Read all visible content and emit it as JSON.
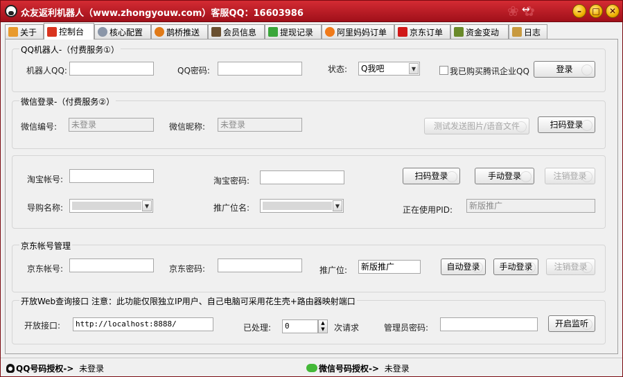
{
  "window": {
    "title": "众友返利机器人（www.zhongyouw.com）客服QQ：16603986",
    "resize_glyph": "↔",
    "min_glyph": "–",
    "max_glyph": "□",
    "close_glyph": "✕"
  },
  "tabs": [
    {
      "label": "关于",
      "icon": "home-icon",
      "color": "#e89a2e"
    },
    {
      "label": "控制台",
      "icon": "shield-icon",
      "color": "#d9341f"
    },
    {
      "label": "核心配置",
      "icon": "gear-icon",
      "color": "#8a96a8"
    },
    {
      "label": "鹊桥推送",
      "icon": "clock-icon",
      "color": "#e07a18"
    },
    {
      "label": "会员信息",
      "icon": "users-icon",
      "color": "#6a5030"
    },
    {
      "label": "提现记录",
      "icon": "check-icon",
      "color": "#3aa63a"
    },
    {
      "label": "阿里妈妈订单",
      "icon": "alimama-icon",
      "color": "#f07a1a"
    },
    {
      "label": "京东订单",
      "icon": "jd-icon",
      "color": "#d01818"
    },
    {
      "label": "资金变动",
      "icon": "money-icon",
      "color": "#6a8a2a"
    },
    {
      "label": "日志",
      "icon": "log-icon",
      "color": "#c89a40"
    }
  ],
  "qq_robot": {
    "legend": "QQ机器人-（付费服务①）",
    "robot_qq_label": "机器人QQ:",
    "robot_qq_value": "",
    "qq_password_label": "QQ密码:",
    "qq_password_value": "",
    "status_label": "状态:",
    "status_value": "Q我吧",
    "enterprise_checkbox_label": "我已购买腾讯企业QQ",
    "enterprise_checked": false,
    "login_button": "登录"
  },
  "wechat_login": {
    "legend": "微信登录-（付费服务②）",
    "wechat_id_label": "微信编号:",
    "wechat_id_value": "未登录",
    "nickname_label": "微信昵称:",
    "nickname_value": "未登录",
    "test_send_button": "测试发送图片/语音文件",
    "scan_login_button": "扫码登录"
  },
  "taobao": {
    "account_label": "淘宝帐号:",
    "account_value": "",
    "password_label": "淘宝密码:",
    "password_value": "",
    "scan_login_button": "扫码登录",
    "manual_login_button": "手动登录",
    "logout_button": "注销登录",
    "guide_name_label": "导购名称:",
    "promo_slot_label": "推广位名:",
    "pid_label": "正在使用PID:",
    "pid_value": "新版推广"
  },
  "jd": {
    "legend": "京东帐号管理",
    "account_label": "京东帐号:",
    "account_value": "",
    "password_label": "京东密码:",
    "password_value": "",
    "promo_label": "推广位:",
    "promo_value": "新版推广",
    "auto_login_button": "自动登录",
    "manual_login_button": "手动登录",
    "logout_button": "注销登录"
  },
  "web_api": {
    "legend": "开放Web查询接口 注意：此功能仅限独立IP用户、自己电脑可采用花生壳+路由器映射端口",
    "port_label": "开放接口:",
    "port_value": "http://localhost:8888/",
    "processed_label": "已处理:",
    "processed_value": "0",
    "processed_unit": "次请求",
    "admin_password_label": "管理员密码:",
    "admin_password_value": "",
    "start_listen_button": "开启监听"
  },
  "statusbar": {
    "qq_label": "QQ号码授权->",
    "qq_status": "未登录",
    "wechat_label": "微信号码授权->",
    "wechat_status": "未登录"
  }
}
